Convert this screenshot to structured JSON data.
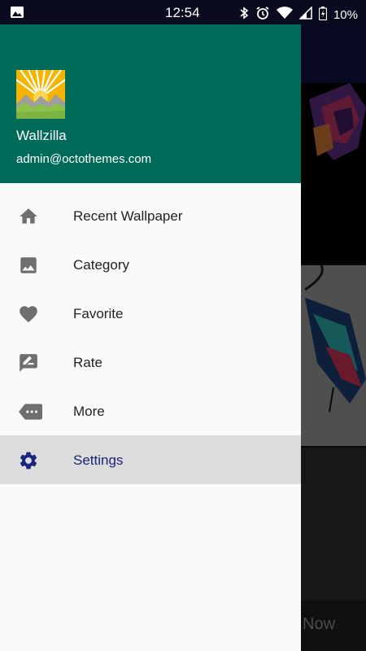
{
  "status_bar": {
    "time": "12:54",
    "battery": "10%",
    "icons": [
      "image-icon",
      "bluetooth-icon",
      "alarm-icon",
      "wifi-icon",
      "signal-icon",
      "battery-charging-icon"
    ]
  },
  "drawer": {
    "app_name": "Wallzilla",
    "email": "admin@octothemes.com",
    "header_color": "#006b59",
    "items": [
      {
        "label": "Recent Wallpaper",
        "icon": "home-icon"
      },
      {
        "label": "Category",
        "icon": "image-icon"
      },
      {
        "label": "Favorite",
        "icon": "heart-icon"
      },
      {
        "label": "Rate",
        "icon": "rate-review-icon"
      },
      {
        "label": "More",
        "icon": "more-tag-icon"
      },
      {
        "label": "Settings",
        "icon": "gear-icon",
        "selected": true
      }
    ]
  },
  "background": {
    "button_text": "Now"
  },
  "colors": {
    "accent": "#1a237e",
    "icon": "#6f6f6f",
    "selected_bg": "#dcdcdc"
  }
}
